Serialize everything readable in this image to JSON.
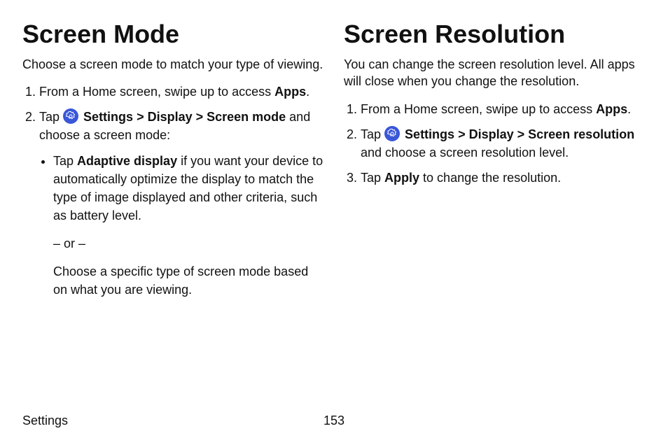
{
  "footer": {
    "section": "Settings",
    "page": "153"
  },
  "left": {
    "heading": "Screen Mode",
    "intro": "Choose a screen mode to match your type of viewing.",
    "step1_prefix": "From a Home screen, swipe up to access ",
    "step1_bold": "Apps",
    "step1_suffix": ".",
    "step2_prefix": "Tap ",
    "step2_settings": "Settings",
    "step2_sep1": " > ",
    "step2_display": "Display",
    "step2_sep2": " > ",
    "step2_screenmode": "Screen mode",
    "step2_suffix": " and choose a screen mode:",
    "bullet_prefix": "Tap ",
    "bullet_bold": "Adaptive display",
    "bullet_suffix": " if you want your device to automatically optimize the display to match the type of image displayed and other criteria, such as battery level.",
    "or": "– or –",
    "alt": "Choose a specific type of screen mode based on what you are viewing."
  },
  "right": {
    "heading": "Screen Resolution",
    "intro": "You can change the screen resolution level. All apps will close when you change the resolution.",
    "step1_prefix": "From a Home screen, swipe up to access ",
    "step1_bold": "Apps",
    "step1_suffix": ".",
    "step2_prefix": "Tap ",
    "step2_settings": "Settings",
    "step2_sep1": " > ",
    "step2_display": "Display",
    "step2_sep2": " > ",
    "step2_screenres": "Screen resolution",
    "step2_suffix": " and choose a screen resolution level.",
    "step3_prefix": "Tap ",
    "step3_bold": "Apply",
    "step3_suffix": " to change the resolution."
  }
}
